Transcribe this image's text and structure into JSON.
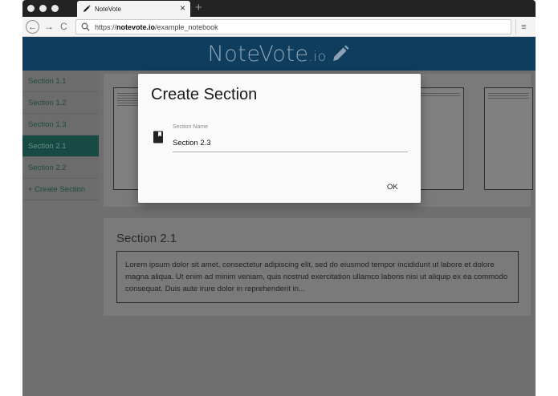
{
  "browser": {
    "tab_title": "NoteVote",
    "tab_close": "×",
    "new_tab": "+",
    "url_prefix": "https://",
    "url_domain": "notevote.io",
    "url_path": "/example_notebook",
    "back_glyph": "←",
    "forward_glyph": "→",
    "reload_glyph": "C",
    "menu_glyph": "≡"
  },
  "app": {
    "brand_main": "NoteVote",
    "brand_sub": ".io",
    "colors": {
      "header": "#0e3d5d",
      "accent": "#174a42"
    }
  },
  "sidebar": {
    "items": [
      {
        "label": "Section 1.1",
        "active": false
      },
      {
        "label": "Section 1.2",
        "active": false
      },
      {
        "label": "Section 1.3",
        "active": false
      },
      {
        "label": "Section 2.1",
        "active": true
      },
      {
        "label": "Section 2.2",
        "active": false
      }
    ],
    "create_label": "+ Create Section"
  },
  "section": {
    "title": "Section 2.1",
    "body": "Lorem ipsum dolor sit amet, consectetur adipiscing elit, sed do eiusmod tempor incididunt ut labore et dolore magna aliqua. Ut enim ad minim veniam, quis nostrud exercitation ullamco laboris nisi ut aliquip ex ea commodo consequat. Duis aute irure dolor in reprehenderit in..."
  },
  "modal": {
    "title": "Create Section",
    "field_label": "Section Name",
    "field_value": "Section 2.3",
    "ok_label": "OK",
    "field_icon": "notebook-icon"
  }
}
